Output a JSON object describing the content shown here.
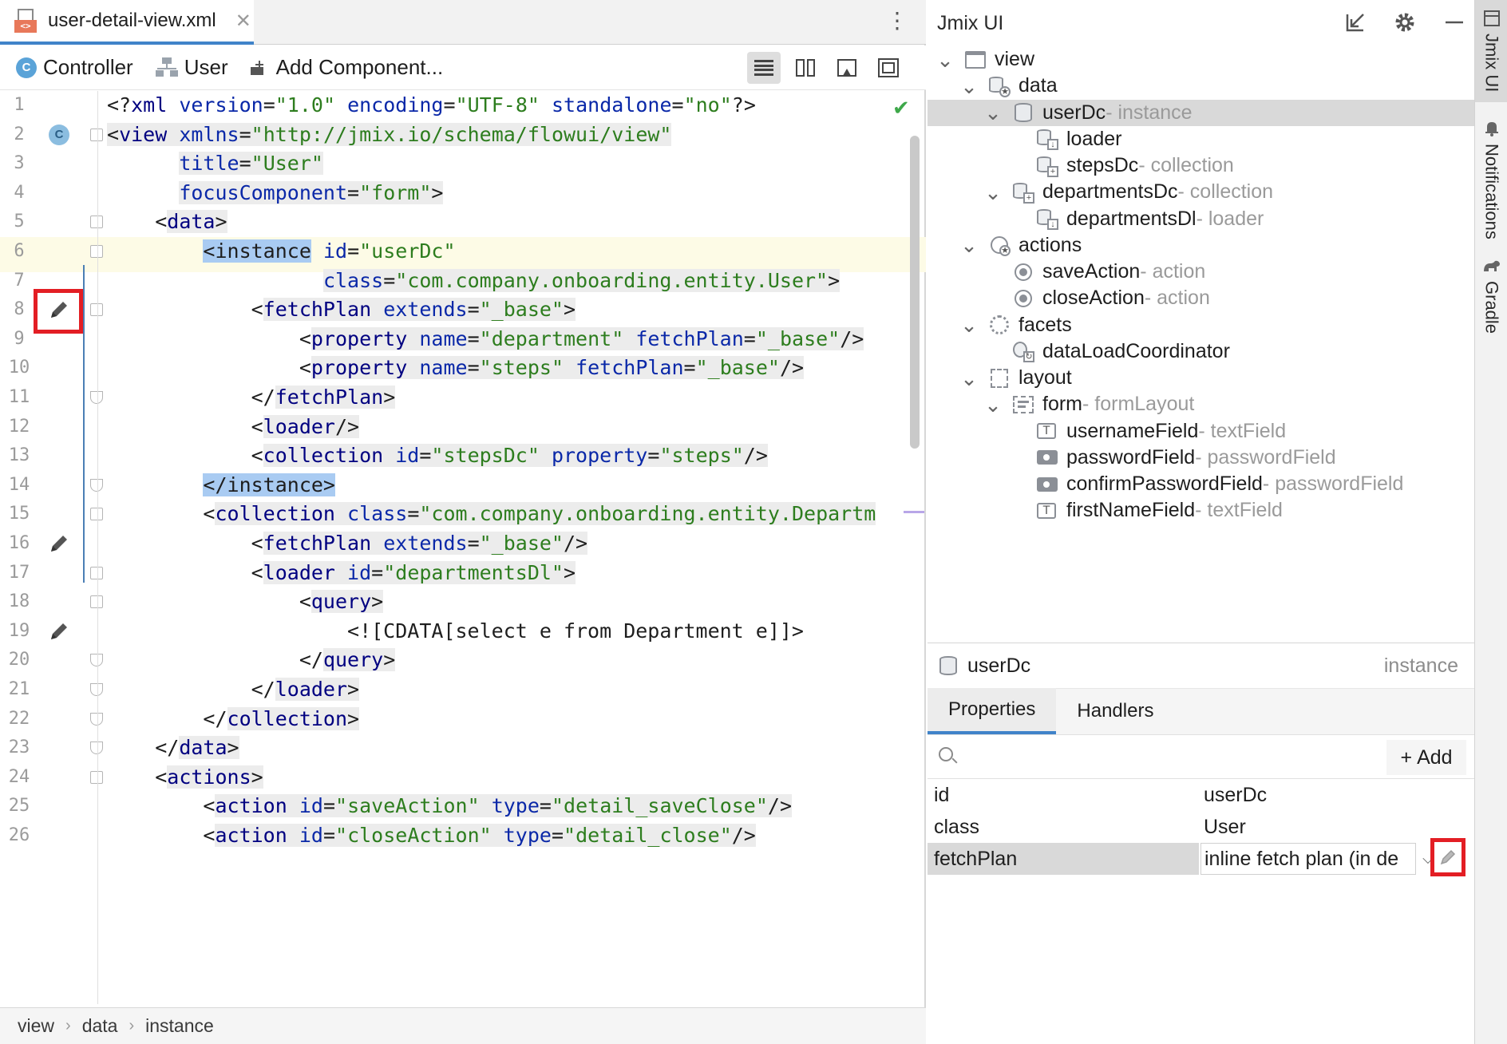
{
  "editor": {
    "tab": {
      "filename": "user-detail-view.xml",
      "close": "✕"
    },
    "more": "⋮",
    "toolbar": {
      "controller": "Controller",
      "entity": "User",
      "add_component": "Add Component..."
    },
    "lines": [
      {
        "n": "1",
        "t": [
          [
            "pl",
            "<?"
          ],
          [
            "kw",
            "xml"
          ],
          [
            "pl",
            " "
          ],
          [
            "at",
            "version"
          ],
          [
            "pl",
            "="
          ],
          [
            "st",
            "\"1.0\""
          ],
          [
            "pl",
            " "
          ],
          [
            "at",
            "encoding"
          ],
          [
            "pl",
            "="
          ],
          [
            "st",
            "\"UTF-8\""
          ],
          [
            "pl",
            " "
          ],
          [
            "at",
            "standalone"
          ],
          [
            "pl",
            "="
          ],
          [
            "st",
            "\"no\""
          ],
          [
            "pl",
            "?>"
          ]
        ]
      },
      {
        "n": "2",
        "t": [
          [
            "pl",
            "<"
          ],
          [
            "tg",
            "view"
          ],
          [
            "pl",
            " "
          ],
          [
            "at",
            "xmlns"
          ],
          [
            "pl",
            "="
          ],
          [
            "st",
            "\"http://jmix.io/schema/flowui/view\""
          ]
        ]
      },
      {
        "n": "3",
        "t": [
          [
            "pl",
            "      "
          ],
          [
            "at",
            "title"
          ],
          [
            "pl",
            "="
          ],
          [
            "st",
            "\"User\""
          ]
        ]
      },
      {
        "n": "4",
        "t": [
          [
            "pl",
            "      "
          ],
          [
            "at",
            "focusComponent"
          ],
          [
            "pl",
            "="
          ],
          [
            "st",
            "\"form\""
          ],
          [
            "pl",
            ">"
          ]
        ]
      },
      {
        "n": "5",
        "t": [
          [
            "pl",
            "    <"
          ],
          [
            "tg",
            "data"
          ],
          [
            "pl",
            ">"
          ]
        ]
      },
      {
        "n": "6",
        "t": [
          [
            "pl",
            "        "
          ],
          [
            "selw",
            "<instance"
          ],
          [
            "pl",
            " "
          ],
          [
            "at",
            "id"
          ],
          [
            "pl",
            "="
          ],
          [
            "st",
            "\"userDc\""
          ]
        ]
      },
      {
        "n": "7",
        "t": [
          [
            "pl",
            "                  "
          ],
          [
            "at",
            "class"
          ],
          [
            "pl",
            "="
          ],
          [
            "st",
            "\"com.company.onboarding.entity.User\""
          ],
          [
            "pl",
            ">"
          ]
        ]
      },
      {
        "n": "8",
        "t": [
          [
            "pl",
            "            <"
          ],
          [
            "tg",
            "fetchPlan"
          ],
          [
            "pl",
            " "
          ],
          [
            "at",
            "extends"
          ],
          [
            "pl",
            "="
          ],
          [
            "st",
            "\"_base\""
          ],
          [
            "pl",
            ">"
          ]
        ]
      },
      {
        "n": "9",
        "t": [
          [
            "pl",
            "                <"
          ],
          [
            "tg",
            "property"
          ],
          [
            "pl",
            " "
          ],
          [
            "at",
            "name"
          ],
          [
            "pl",
            "="
          ],
          [
            "st",
            "\"department\""
          ],
          [
            "pl",
            " "
          ],
          [
            "at",
            "fetchPlan"
          ],
          [
            "pl",
            "="
          ],
          [
            "st",
            "\"_base\""
          ],
          [
            "pl",
            "/>"
          ]
        ]
      },
      {
        "n": "10",
        "t": [
          [
            "pl",
            "                <"
          ],
          [
            "tg",
            "property"
          ],
          [
            "pl",
            " "
          ],
          [
            "at",
            "name"
          ],
          [
            "pl",
            "="
          ],
          [
            "st",
            "\"steps\""
          ],
          [
            "pl",
            " "
          ],
          [
            "at",
            "fetchPlan"
          ],
          [
            "pl",
            "="
          ],
          [
            "st",
            "\"_base\""
          ],
          [
            "pl",
            "/>"
          ]
        ]
      },
      {
        "n": "11",
        "t": [
          [
            "pl",
            "            </"
          ],
          [
            "tg",
            "fetchPlan"
          ],
          [
            "pl",
            ">"
          ]
        ]
      },
      {
        "n": "12",
        "t": [
          [
            "pl",
            "            <"
          ],
          [
            "tg",
            "loader"
          ],
          [
            "pl",
            "/>"
          ]
        ]
      },
      {
        "n": "13",
        "t": [
          [
            "pl",
            "            <"
          ],
          [
            "tg",
            "collection"
          ],
          [
            "pl",
            " "
          ],
          [
            "at",
            "id"
          ],
          [
            "pl",
            "="
          ],
          [
            "st",
            "\"stepsDc\""
          ],
          [
            "pl",
            " "
          ],
          [
            "at",
            "property"
          ],
          [
            "pl",
            "="
          ],
          [
            "st",
            "\"steps\""
          ],
          [
            "pl",
            "/>"
          ]
        ]
      },
      {
        "n": "14",
        "t": [
          [
            "pl",
            "        "
          ],
          [
            "selw",
            "</instance>"
          ]
        ]
      },
      {
        "n": "15",
        "t": [
          [
            "pl",
            "        <"
          ],
          [
            "tg",
            "collection"
          ],
          [
            "pl",
            " "
          ],
          [
            "at",
            "class"
          ],
          [
            "pl",
            "="
          ],
          [
            "st",
            "\"com.company.onboarding.entity.Departm"
          ]
        ]
      },
      {
        "n": "16",
        "t": [
          [
            "pl",
            "            <"
          ],
          [
            "tg",
            "fetchPlan"
          ],
          [
            "pl",
            " "
          ],
          [
            "at",
            "extends"
          ],
          [
            "pl",
            "="
          ],
          [
            "st",
            "\"_base\""
          ],
          [
            "pl",
            "/>"
          ]
        ]
      },
      {
        "n": "17",
        "t": [
          [
            "pl",
            "            <"
          ],
          [
            "tg",
            "loader"
          ],
          [
            "pl",
            " "
          ],
          [
            "at",
            "id"
          ],
          [
            "pl",
            "="
          ],
          [
            "st",
            "\"departmentsDl\""
          ],
          [
            "pl",
            ">"
          ]
        ]
      },
      {
        "n": "18",
        "t": [
          [
            "pl",
            "                <"
          ],
          [
            "tg",
            "query"
          ],
          [
            "pl",
            ">"
          ]
        ]
      },
      {
        "n": "19",
        "t": [
          [
            "pl",
            "                    <![CDATA[select e from Department e]]>"
          ]
        ]
      },
      {
        "n": "20",
        "t": [
          [
            "pl",
            "                </"
          ],
          [
            "tg",
            "query"
          ],
          [
            "pl",
            ">"
          ]
        ]
      },
      {
        "n": "21",
        "t": [
          [
            "pl",
            "            </"
          ],
          [
            "tg",
            "loader"
          ],
          [
            "pl",
            ">"
          ]
        ]
      },
      {
        "n": "22",
        "t": [
          [
            "pl",
            "        </"
          ],
          [
            "tg",
            "collection"
          ],
          [
            "pl",
            ">"
          ]
        ]
      },
      {
        "n": "23",
        "t": [
          [
            "pl",
            "    </"
          ],
          [
            "tg",
            "data"
          ],
          [
            "pl",
            ">"
          ]
        ]
      },
      {
        "n": "24",
        "t": [
          [
            "pl",
            "    <"
          ],
          [
            "tg",
            "actions"
          ],
          [
            "pl",
            ">"
          ]
        ]
      },
      {
        "n": "25",
        "t": [
          [
            "pl",
            "        <"
          ],
          [
            "tg",
            "action"
          ],
          [
            "pl",
            " "
          ],
          [
            "at",
            "id"
          ],
          [
            "pl",
            "="
          ],
          [
            "st",
            "\"saveAction\""
          ],
          [
            "pl",
            " "
          ],
          [
            "at",
            "type"
          ],
          [
            "pl",
            "="
          ],
          [
            "st",
            "\"detail_saveClose\""
          ],
          [
            "pl",
            "/>"
          ]
        ]
      },
      {
        "n": "26",
        "t": [
          [
            "pl",
            "        <"
          ],
          [
            "tg",
            "action"
          ],
          [
            "pl",
            " "
          ],
          [
            "at",
            "id"
          ],
          [
            "pl",
            "="
          ],
          [
            "st",
            "\"closeAction\""
          ],
          [
            "pl",
            " "
          ],
          [
            "at",
            "type"
          ],
          [
            "pl",
            "="
          ],
          [
            "st",
            "\"detail_close\""
          ],
          [
            "pl",
            "/>"
          ]
        ]
      }
    ],
    "breadcrumb": [
      "view",
      "data",
      "instance"
    ],
    "breadcrumb_sep": "›",
    "check": "✔"
  },
  "jmix": {
    "title": "Jmix UI",
    "tree": [
      {
        "label": "view",
        "type": "",
        "icon": "window-icon",
        "chev": true
      },
      {
        "label": "data",
        "type": "",
        "icon": "data-icon",
        "chev": true
      },
      {
        "label": "userDc",
        "type": " - instance",
        "icon": "instance-icon",
        "chev": true,
        "selected": true
      },
      {
        "label": "loader",
        "type": "",
        "icon": "loader-icon",
        "chev": false
      },
      {
        "label": "stepsDc",
        "type": " - collection",
        "icon": "collection-icon",
        "chev": false
      },
      {
        "label": "departmentsDc",
        "type": " - collection",
        "icon": "collection-icon",
        "chev": true
      },
      {
        "label": "departmentsDl",
        "type": " - loader",
        "icon": "loader-icon",
        "chev": false
      },
      {
        "label": "actions",
        "type": "",
        "icon": "actions-icon",
        "chev": true
      },
      {
        "label": "saveAction",
        "type": " - action",
        "icon": "action-icon",
        "chev": false
      },
      {
        "label": "closeAction",
        "type": " - action",
        "icon": "action-icon",
        "chev": false
      },
      {
        "label": "facets",
        "type": "",
        "icon": "facets-icon",
        "chev": true
      },
      {
        "label": "dataLoadCoordinator",
        "type": "",
        "icon": "coordinator-icon",
        "chev": false
      },
      {
        "label": "layout",
        "type": "",
        "icon": "layout-icon",
        "chev": true
      },
      {
        "label": "form",
        "type": " - formLayout",
        "icon": "form-icon",
        "chev": true
      },
      {
        "label": "usernameField",
        "type": " - textField",
        "icon": "textfield-icon",
        "chev": false
      },
      {
        "label": "passwordField",
        "type": " - passwordField",
        "icon": "passwordfield-icon",
        "chev": false
      },
      {
        "label": "confirmPasswordField",
        "type": " - passwordField",
        "icon": "passwordfield-icon",
        "chev": false
      },
      {
        "label": "firstNameField",
        "type": " - textField",
        "icon": "textfield-icon",
        "chev": false
      }
    ],
    "props": {
      "component": "userDc",
      "component_type": "instance",
      "tabs": [
        "Properties",
        "Handlers"
      ],
      "add_label": "Add",
      "rows": [
        {
          "key": "id",
          "value": "userDc"
        },
        {
          "key": "class",
          "value": "User"
        },
        {
          "key": "fetchPlan",
          "value": "inline fetch plan (in de"
        }
      ]
    }
  },
  "strip": {
    "tabs": [
      "Jmix UI",
      "Notifications",
      "Gradle"
    ]
  }
}
